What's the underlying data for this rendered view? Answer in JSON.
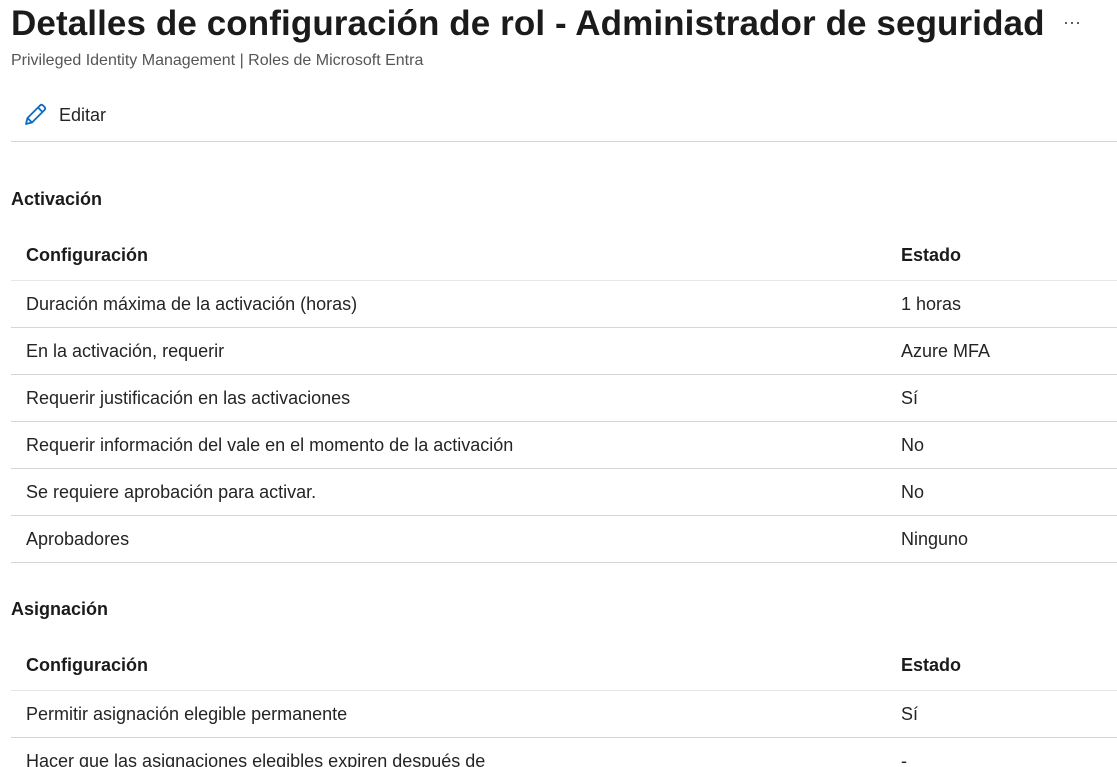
{
  "page": {
    "title": "Detalles de configuración de rol - Administrador de seguridad",
    "subtitle": "Privileged Identity Management | Roles de Microsoft Entra",
    "more_label": "···"
  },
  "toolbar": {
    "edit_label": "Editar",
    "edit_icon": "pencil-icon"
  },
  "colors": {
    "accent": "#0f6cbd",
    "divider": "#d6d6d6",
    "text": "#242424"
  },
  "activation": {
    "title": "Activación",
    "columns": [
      "Configuración",
      "Estado"
    ],
    "rows": [
      [
        "Duración máxima de la activación (horas)",
        "1 horas"
      ],
      [
        "En la activación, requerir",
        "Azure MFA"
      ],
      [
        "Requerir justificación en las activaciones",
        "Sí"
      ],
      [
        "Requerir información del vale en el momento de la activación",
        "No"
      ],
      [
        "Se requiere aprobación para activar.",
        "No"
      ],
      [
        "Aprobadores",
        "Ninguno"
      ]
    ]
  },
  "assignment": {
    "title": "Asignación",
    "columns": [
      "Configuración",
      "Estado"
    ],
    "rows": [
      [
        "Permitir asignación elegible permanente",
        "Sí"
      ],
      [
        "Hacer que las asignaciones elegibles expiren después de",
        "-"
      ]
    ]
  }
}
